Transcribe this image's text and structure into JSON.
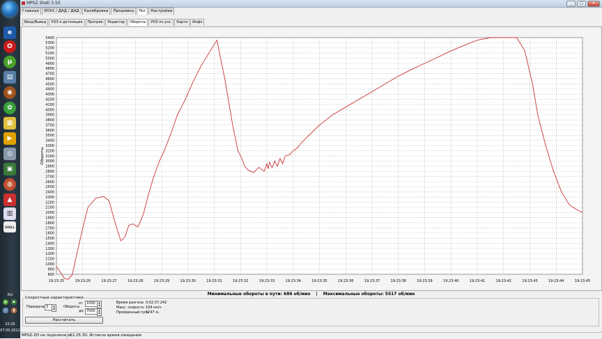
{
  "window": {
    "title": "MPSZ Shell 3.50"
  },
  "menu": [
    "Главная",
    "ЭПХХ / ДАД / ДАД",
    "Калибровки",
    "Прошивка",
    "Лог",
    "Настройки"
  ],
  "menu_active": 4,
  "subtabs": [
    "Ввод/Вывод",
    "УОЗ и детонация",
    "Прогрев",
    "Редактор",
    "Обороты",
    "УОЗ по уск.",
    "Карта",
    "Инфо"
  ],
  "subtab_active": 4,
  "chart_data": {
    "type": "line",
    "ylabel": "Обороты",
    "ylim": [
      800,
      5400
    ],
    "y_ticks": [
      800,
      900,
      1000,
      1100,
      1200,
      1300,
      1400,
      1500,
      1600,
      1700,
      1800,
      1900,
      2000,
      2100,
      2200,
      2300,
      2400,
      2500,
      2600,
      2700,
      2800,
      2900,
      3000,
      3100,
      3200,
      3300,
      3400,
      3500,
      3600,
      3700,
      3800,
      3900,
      4000,
      4100,
      4200,
      4300,
      4400,
      4500,
      4600,
      4700,
      4800,
      4900,
      5000,
      5100,
      5200,
      5300,
      5400
    ],
    "x_ticks": [
      "19:23:25",
      "19:23:26",
      "19:23:27",
      "19:23:28",
      "19:23:29",
      "19:23:30",
      "19:23:31",
      "19:23:32",
      "19:23:33",
      "19:23:34",
      "19:23:35",
      "19:23:36",
      "19:23:37",
      "19:23:38",
      "19:23:39",
      "19:23:40",
      "19:23:41",
      "19:23:42",
      "19:23:43",
      "19:23:44",
      "19:23:45"
    ],
    "grid": true,
    "series": [
      {
        "color": "#c83232",
        "x": [
          0.0,
          0.15,
          0.3,
          0.45,
          0.6,
          0.8,
          1.0,
          1.2,
          1.5,
          1.8,
          2.0,
          2.2,
          2.45,
          2.6,
          2.75,
          2.9,
          3.1,
          3.3,
          3.5,
          3.7,
          3.9,
          4.1,
          4.4,
          4.6,
          4.9,
          5.2,
          5.5,
          5.8,
          6.1,
          6.4,
          6.7,
          6.9,
          7.05,
          7.15,
          7.3,
          7.5,
          7.7,
          7.9,
          8.0,
          8.05,
          8.1,
          8.2,
          8.3,
          8.4,
          8.5,
          8.6,
          8.7,
          8.85,
          9.0,
          9.15,
          9.3,
          9.5,
          9.8,
          10.0,
          10.5,
          11.0,
          11.5,
          12.0,
          12.5,
          13.0,
          13.5,
          14.0,
          14.5,
          15.0,
          15.5,
          16.0,
          16.5,
          17.0,
          17.5,
          17.8,
          18.1,
          18.3,
          18.6,
          18.9,
          19.2,
          19.5,
          19.8,
          20.0
        ],
        "y": [
          950,
          840,
          720,
          700,
          790,
          1250,
          1700,
          2100,
          2280,
          2310,
          2230,
          1850,
          1450,
          1520,
          1750,
          1780,
          1720,
          1960,
          2350,
          2700,
          2980,
          3200,
          3600,
          3900,
          4200,
          4550,
          4850,
          5100,
          5350,
          4600,
          3700,
          3200,
          3050,
          2900,
          2820,
          2780,
          2880,
          2800,
          2950,
          2850,
          2980,
          2870,
          3000,
          2900,
          3050,
          2950,
          3100,
          3120,
          3200,
          3250,
          3350,
          3450,
          3600,
          3700,
          3900,
          4050,
          4200,
          4350,
          4500,
          4650,
          4780,
          4900,
          5020,
          5140,
          5250,
          5350,
          5400,
          5400,
          5400,
          5150,
          4500,
          3900,
          3300,
          2800,
          2400,
          2150,
          2050,
          2000
        ]
      }
    ]
  },
  "summary": {
    "min_text": "Минимальные обороты в пути: 686 об/мин",
    "separator": "|",
    "max_text": "Максимальные обороты: 5517 об/мин"
  },
  "speed": {
    "legend": "Скоростные характеристики",
    "gear_label": "Передача",
    "gear_value": "3",
    "rpm_label": "Обороты",
    "from_label": "от",
    "from_value": "1000",
    "to_label": "до",
    "to_value": "7000",
    "race_time_label": "Время разгона",
    "race_time_value": "0:02:37.242",
    "max_speed_label": "Макс. скорость",
    "max_speed_value": "109 км/ч",
    "distance_label": "Пройденный путь",
    "distance_value": "1747 м.",
    "calc_button": "Рассчитать"
  },
  "status": {
    "left": "MPSZ-ZH не подключено",
    "right": "22:25:30: Истекло время ожидания"
  },
  "taskbar": {
    "lang": "RU",
    "time": "22:25",
    "date": "07.05.2011",
    "shell_label": "SHELL"
  }
}
